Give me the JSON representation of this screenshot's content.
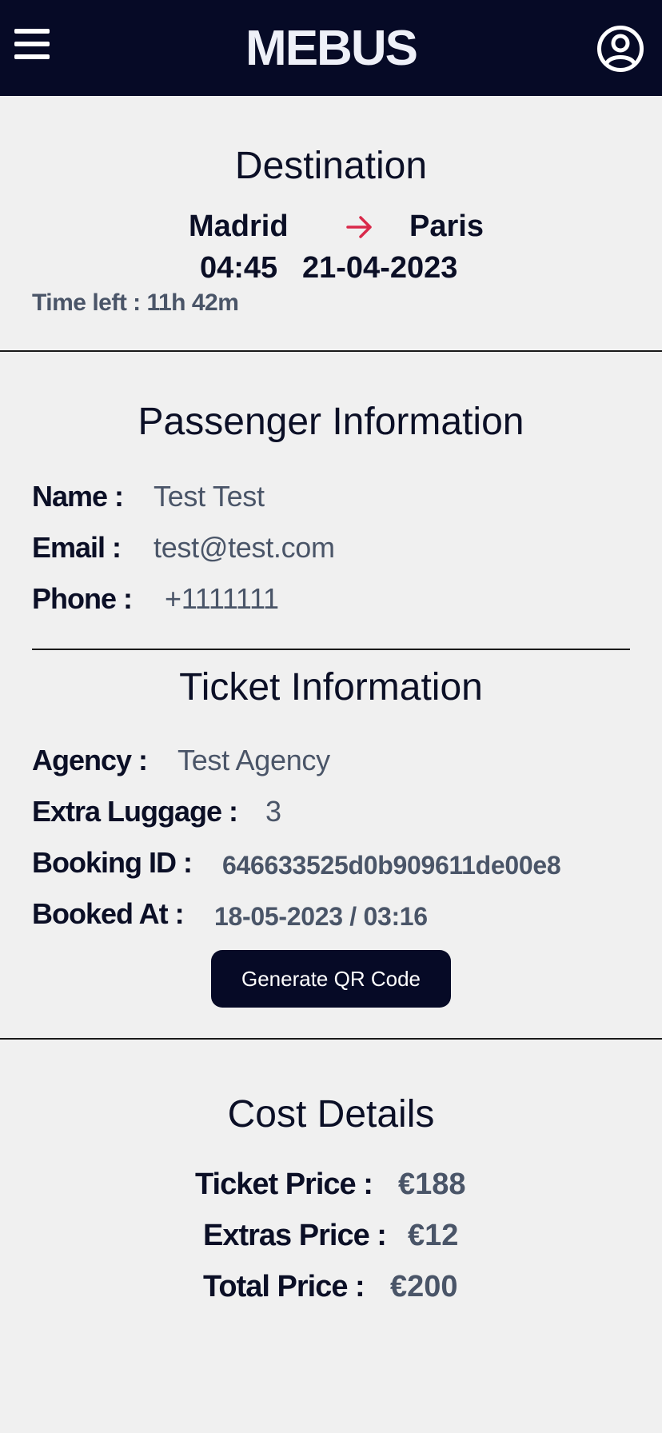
{
  "header": {
    "brand": "MEBUS",
    "menu_icon": "hamburger-menu-icon",
    "user_icon": "user-circle-icon",
    "bg_color": "#060a26"
  },
  "destination": {
    "title": "Destination",
    "from": "Madrid",
    "to": "Paris",
    "arrow_icon": "arrow-right-icon",
    "arrow_color": "#d9294a",
    "time": "04:45",
    "date": "21-04-2023",
    "time_left": "Time left : 11h 42m"
  },
  "passenger": {
    "title": "Passenger Information",
    "name_label": "Name :",
    "name_value": "Test Test",
    "email_label": "Email :",
    "email_value": "test@test.com",
    "phone_label": "Phone :",
    "phone_value": "+1111111"
  },
  "ticket": {
    "title": "Ticket Information",
    "agency_label": "Agency :",
    "agency_value": "Test Agency",
    "luggage_label": "Extra Luggage :",
    "luggage_value": "3",
    "booking_id_label": "Booking ID :",
    "booking_id_value": "646633525d0b909611de00e8",
    "booked_at_label": "Booked At :",
    "booked_at_value": "18-05-2023 / 03:16",
    "qr_button": "Generate QR Code"
  },
  "cost": {
    "title": "Cost Details",
    "ticket_price_label": "Ticket Price :",
    "ticket_price_value": "€188",
    "extras_price_label": "Extras Price :",
    "extras_price_value": "€12",
    "total_price_label": "Total Price :",
    "total_price_value": "€200"
  }
}
